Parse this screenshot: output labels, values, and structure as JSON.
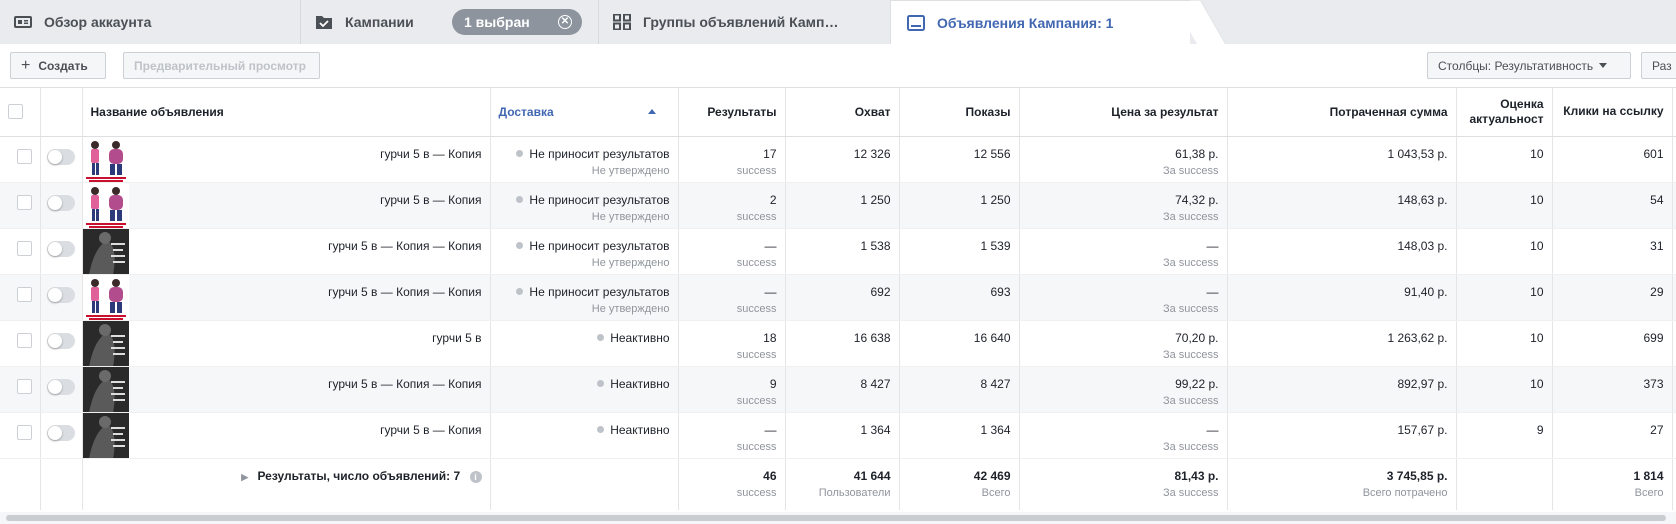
{
  "tabs": {
    "account": "Обзор аккаунта",
    "campaigns": "Кампании",
    "selected": "1 выбран",
    "adsets": "Группы объявлений Камп…",
    "ads": "Объявления Кампания: 1"
  },
  "toolbar": {
    "create": "Создать",
    "preview": "Предварительный просмотр",
    "columns": "Столбцы: Результативность",
    "breakdown": "Раз"
  },
  "columns": {
    "name": "Название объявления",
    "delivery": "Доставка",
    "results": "Результаты",
    "reach": "Охват",
    "impressions": "Показы",
    "cpr": "Цена за результат",
    "spent": "Потраченная сумма",
    "relevance": "Оценка актуальност",
    "clicks": "Клики на ссылку"
  },
  "rows": [
    {
      "name": "гурчи 5 в — Копия",
      "thumb": "illus",
      "status": "Не приносит результатов",
      "status_sub": "Не утверждено",
      "results": "17",
      "results_sub": "success",
      "reach": "12 326",
      "impressions": "12 556",
      "cpr": "61,38 р.",
      "cpr_sub": "За success",
      "spent": "1 043,53 р.",
      "relevance": "10",
      "clicks": "601"
    },
    {
      "name": "гурчи 5 в — Копия",
      "thumb": "illus",
      "status": "Не приносит результатов",
      "status_sub": "Не утверждено",
      "results": "2",
      "results_sub": "success",
      "reach": "1 250",
      "impressions": "1 250",
      "cpr": "74,32 р.",
      "cpr_sub": "За success",
      "spent": "148,63 р.",
      "relevance": "10",
      "clicks": "54"
    },
    {
      "name": "гурчи 5 в — Копия — Копия",
      "thumb": "photo",
      "status": "Не приносит результатов",
      "status_sub": "Не утверждено",
      "results": "—",
      "results_sub": "success",
      "reach": "1 538",
      "impressions": "1 539",
      "cpr": "—",
      "cpr_sub": "За success",
      "spent": "148,03 р.",
      "relevance": "10",
      "clicks": "31"
    },
    {
      "name": "гурчи 5 в — Копия — Копия",
      "thumb": "illus",
      "status": "Не приносит результатов",
      "status_sub": "Не утверждено",
      "results": "—",
      "results_sub": "success",
      "reach": "692",
      "impressions": "693",
      "cpr": "—",
      "cpr_sub": "За success",
      "spent": "91,40 р.",
      "relevance": "10",
      "clicks": "29"
    },
    {
      "name": "гурчи 5 в",
      "thumb": "photo",
      "status": "Неактивно",
      "status_sub": "",
      "results": "18",
      "results_sub": "success",
      "reach": "16 638",
      "impressions": "16 640",
      "cpr": "70,20 р.",
      "cpr_sub": "За success",
      "spent": "1 263,62 р.",
      "relevance": "10",
      "clicks": "699"
    },
    {
      "name": "гурчи 5 в — Копия — Копия",
      "thumb": "photo",
      "status": "Неактивно",
      "status_sub": "",
      "results": "9",
      "results_sub": "success",
      "reach": "8 427",
      "impressions": "8 427",
      "cpr": "99,22 р.",
      "cpr_sub": "За success",
      "spent": "892,97 р.",
      "relevance": "10",
      "clicks": "373"
    },
    {
      "name": "гурчи 5 в — Копия",
      "thumb": "photo",
      "status": "Неактивно",
      "status_sub": "",
      "results": "—",
      "results_sub": "success",
      "reach": "1 364",
      "impressions": "1 364",
      "cpr": "—",
      "cpr_sub": "За success",
      "spent": "157,67 р.",
      "relevance": "9",
      "clicks": "27"
    }
  ],
  "totals": {
    "label": "Результаты, число объявлений: 7",
    "results": "46",
    "results_sub": "success",
    "reach": "41 644",
    "reach_sub": "Пользователи",
    "impressions": "42 469",
    "impressions_sub": "Всего",
    "cpr": "81,43 р.",
    "cpr_sub": "За success",
    "spent": "3 745,85 р.",
    "spent_sub": "Всего потрачено",
    "clicks": "1 814",
    "clicks_sub": "Всего"
  }
}
